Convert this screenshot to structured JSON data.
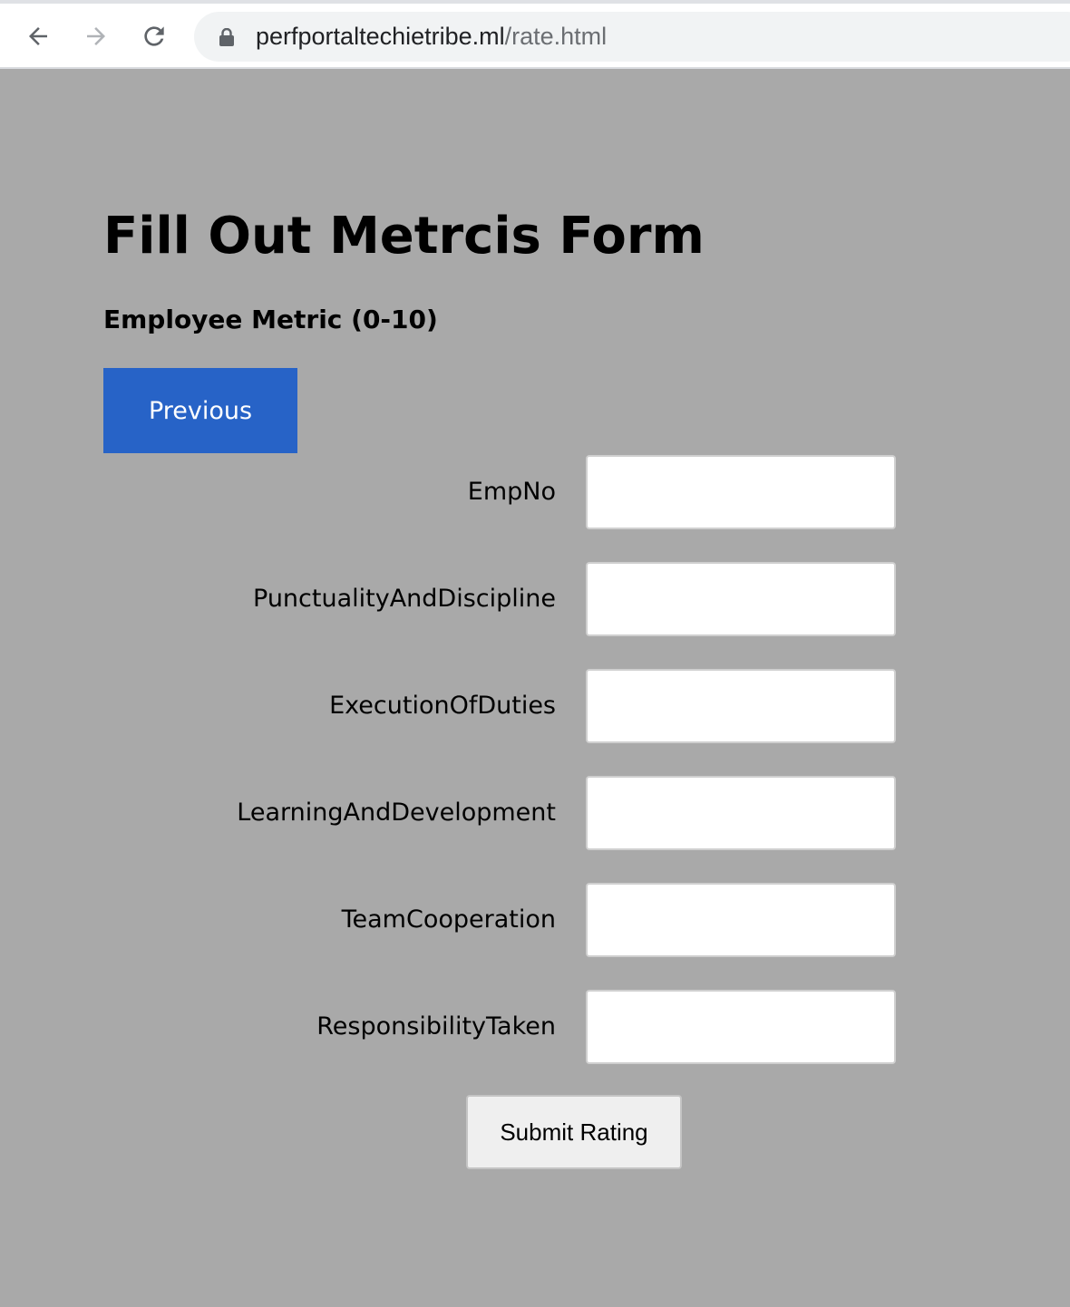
{
  "browser": {
    "url_host": "perfportaltechietribe.ml",
    "url_path": "/rate.html",
    "icons": {
      "back": "arrow-left-icon",
      "forward": "arrow-right-icon",
      "reload": "reload-icon",
      "lock": "lock-icon"
    }
  },
  "page": {
    "title": "Fill Out Metrcis Form",
    "subtitle": "Employee Metric (0-10)",
    "previous_label": "Previous",
    "submit_label": "Submit Rating"
  },
  "form": {
    "fields": [
      {
        "label": "EmpNo",
        "value": ""
      },
      {
        "label": "PunctualityAndDiscipline",
        "value": ""
      },
      {
        "label": "ExecutionOfDuties",
        "value": ""
      },
      {
        "label": "LearningAndDevelopment",
        "value": ""
      },
      {
        "label": "TeamCooperation",
        "value": ""
      },
      {
        "label": "ResponsibilityTaken",
        "value": ""
      }
    ]
  },
  "colors": {
    "page_background": "#a9a9a9",
    "previous_button": "#2763c7",
    "submit_button": "#efefef"
  }
}
